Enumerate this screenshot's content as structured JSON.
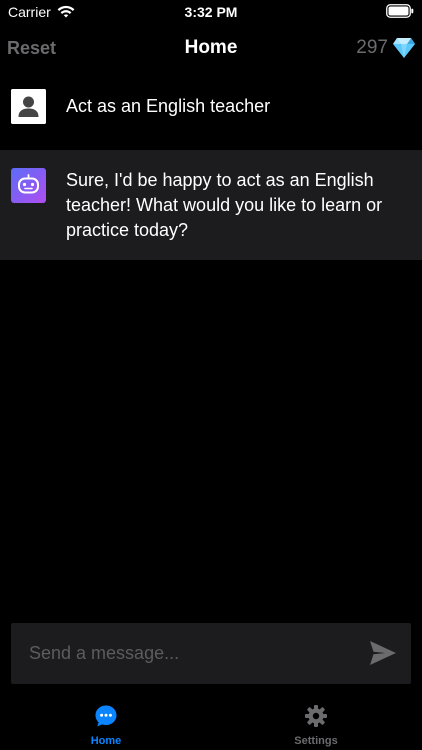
{
  "status_bar": {
    "carrier": "Carrier",
    "time": "3:32 PM",
    "icons": [
      "wifi-icon",
      "battery-icon"
    ]
  },
  "nav": {
    "reset_label": "Reset",
    "title": "Home",
    "credits": "297",
    "credits_icon": "gem-icon"
  },
  "messages": [
    {
      "role": "user",
      "avatar_icon": "user-avatar-icon",
      "text": "Act as an English teacher"
    },
    {
      "role": "bot",
      "avatar_icon": "bot-avatar-icon",
      "text": "Sure, I'd be happy to act as an English teacher! What would you like to learn or practice today?"
    }
  ],
  "composer": {
    "placeholder": "Send a message...",
    "value": "",
    "send_icon": "send-icon"
  },
  "tabs": [
    {
      "label": "Home",
      "icon": "chat-bubble-icon",
      "active": true
    },
    {
      "label": "Settings",
      "icon": "gear-icon",
      "active": false
    }
  ],
  "colors": {
    "background": "#000000",
    "message_highlight": "#1c1c1e",
    "accent": "#0a84ff",
    "muted": "#6b6b6e",
    "gem": "#5ac8fa"
  }
}
